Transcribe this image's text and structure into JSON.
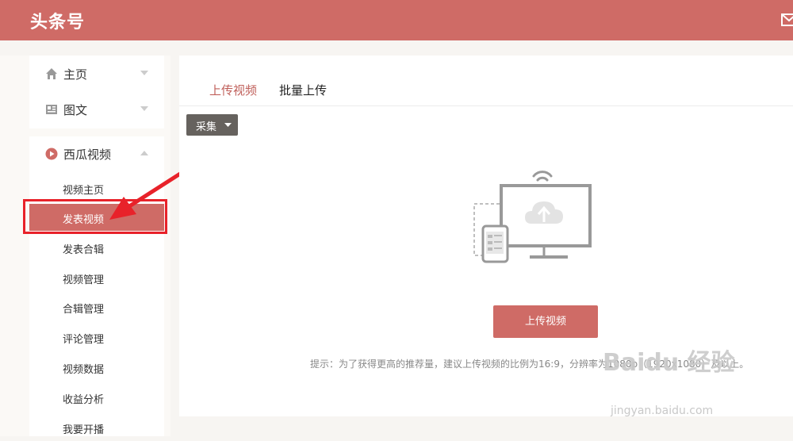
{
  "header": {
    "logo": "头条号",
    "mail_icon": "mail-icon",
    "color": "#cf6b66"
  },
  "sidebar": {
    "top_items": [
      {
        "label": "主页",
        "icon": "home-icon"
      },
      {
        "label": "图文",
        "icon": "article-icon"
      }
    ],
    "video_section": {
      "label": "西瓜视频",
      "icon": "play-circle-icon",
      "items": [
        {
          "label": "视频主页",
          "active": false
        },
        {
          "label": "发表视频",
          "active": true
        },
        {
          "label": "发表合辑",
          "active": false
        },
        {
          "label": "视频管理",
          "active": false
        },
        {
          "label": "合辑管理",
          "active": false
        },
        {
          "label": "评论管理",
          "active": false
        },
        {
          "label": "视频数据",
          "active": false
        },
        {
          "label": "收益分析",
          "active": false
        },
        {
          "label": "我要开播",
          "active": false
        }
      ]
    }
  },
  "main": {
    "tabs": [
      {
        "label": "上传视频",
        "active": true
      },
      {
        "label": "批量上传",
        "active": false
      }
    ],
    "collect_button": "采集",
    "upload_button": "上传视频",
    "hint": "提示：为了获得更高的推荐量，建议上传视频的比例为16:9，分辨率为1080p（1920x1080）及以上。"
  },
  "watermark": {
    "main": "Baidu 经验",
    "sub": "jingyan.baidu.com"
  },
  "annotation_color": "#e8222a"
}
